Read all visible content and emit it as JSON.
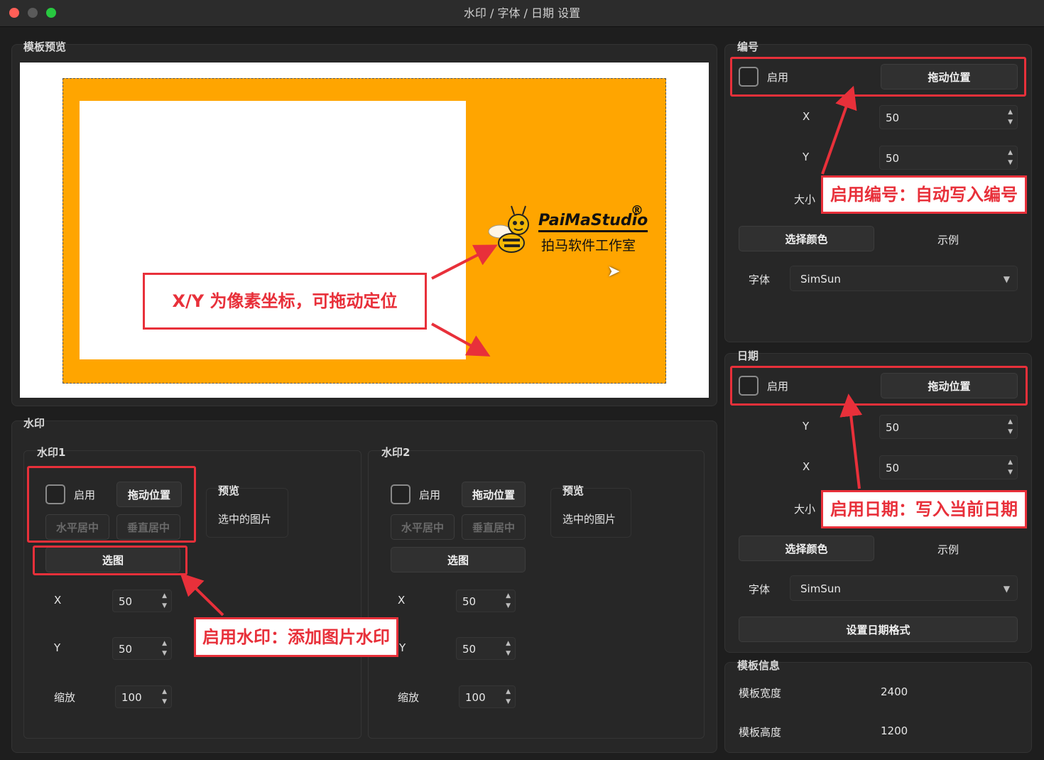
{
  "window": {
    "title": "水印 / 字体 / 日期 设置"
  },
  "preview": {
    "group_label": "模板预览",
    "logo_name": "PaiMaStudio",
    "logo_reg": "®",
    "logo_cn": "拍马软件工作室"
  },
  "number": {
    "group_label": "编号",
    "enable_label": "启用",
    "drag_label": "拖动位置",
    "x_label": "X",
    "x_value": "50",
    "y_label": "Y",
    "y_value": "50",
    "size_label": "大小",
    "color_button": "选择颜色",
    "sample_label": "示例",
    "font_label": "字体",
    "font_value": "SimSun"
  },
  "date": {
    "group_label": "日期",
    "enable_label": "启用",
    "drag_label": "拖动位置",
    "y_label": "Y",
    "y_value": "50",
    "x_label": "X",
    "x_value": "50",
    "size_label": "大小",
    "color_button": "选择颜色",
    "sample_label": "示例",
    "font_label": "字体",
    "font_value": "SimSun",
    "format_button": "设置日期格式"
  },
  "info": {
    "group_label": "模板信息",
    "width_label": "模板宽度",
    "width_value": "2400",
    "height_label": "模板高度",
    "height_value": "1200"
  },
  "watermark": {
    "group_label": "水印",
    "wm1": {
      "label": "水印1",
      "enable_label": "启用",
      "drag_label": "拖动位置",
      "hcenter_label": "水平居中",
      "vcenter_label": "垂直居中",
      "choose_label": "选图",
      "preview_label": "预览",
      "preview_text": "选中的图片",
      "x_label": "X",
      "x_value": "50",
      "y_label": "Y",
      "y_value": "50",
      "scale_label": "缩放",
      "scale_value": "100"
    },
    "wm2": {
      "label": "水印2",
      "enable_label": "启用",
      "drag_label": "拖动位置",
      "hcenter_label": "水平居中",
      "vcenter_label": "垂直居中",
      "choose_label": "选图",
      "preview_label": "预览",
      "preview_text": "选中的图片",
      "x_label": "X",
      "x_value": "50",
      "y_label": "Y",
      "y_value": "50",
      "scale_label": "缩放",
      "scale_value": "100"
    }
  },
  "annotations": {
    "xy_note": "X/Y 为像素坐标，可拖动定位",
    "number_note": "启用编号：自动写入编号",
    "date_note": "启用日期：写入当前日期",
    "watermark_note": "启用水印：添加图片水印"
  },
  "colors": {
    "accent_red": "#e8303a",
    "template_orange": "#ffa500"
  }
}
